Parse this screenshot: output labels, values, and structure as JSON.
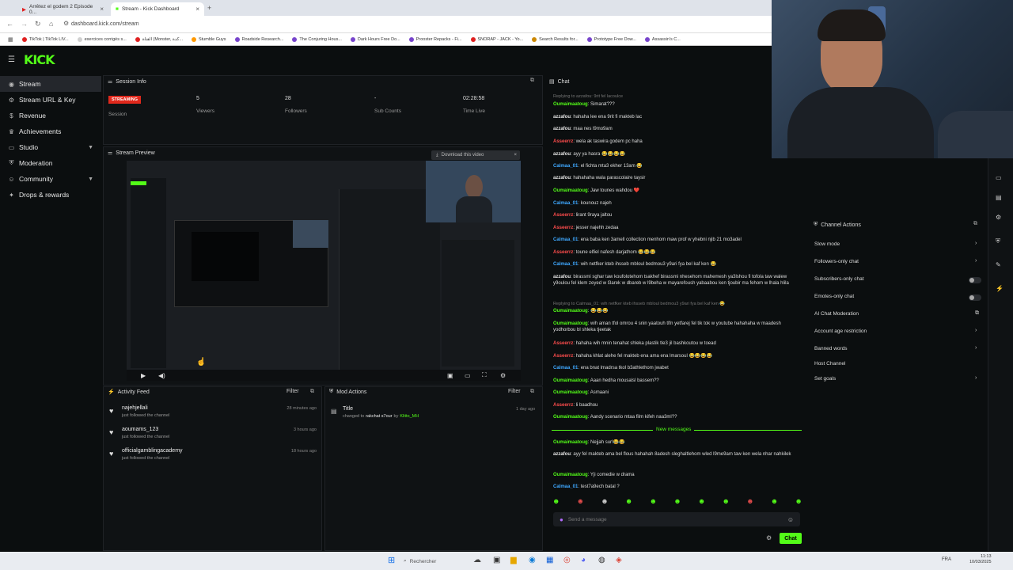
{
  "browser": {
    "tabs": [
      {
        "label": "Arrêtez el godem 2 Episode 0..."
      },
      {
        "label": "Stream - Kick Dashboard"
      }
    ],
    "url": "dashboard.kick.com/stream",
    "bookmarks": [
      {
        "label": "TikTok | TikTok LIV...",
        "color": "#e02020"
      },
      {
        "label": "exercices corrigés s...",
        "color": "#d0d0d0"
      },
      {
        "label": "القناة (Monster, كدة...",
        "color": "#e02020"
      },
      {
        "label": "Stumble Guys",
        "color": "#ff9900"
      },
      {
        "label": "Roadside Research...",
        "color": "#7744cc"
      },
      {
        "label": "The Conjuring Hous...",
        "color": "#7744cc"
      },
      {
        "label": "Dark Hours Free Do...",
        "color": "#7744cc"
      },
      {
        "label": "Prooster Repacks - Fi...",
        "color": "#7744cc"
      },
      {
        "label": "SNORAP - JACK - Yo...",
        "color": "#e02020"
      },
      {
        "label": "Search Results for...",
        "color": "#cc8800"
      },
      {
        "label": "Prototype Free Dow...",
        "color": "#7744cc"
      },
      {
        "label": "Assassin's C...",
        "color": "#7744cc"
      }
    ]
  },
  "app": {
    "logo": "KICK"
  },
  "sidebar": {
    "items": [
      {
        "label": "Stream",
        "icon": "broadcast-icon",
        "active": true
      },
      {
        "label": "Stream URL & Key",
        "icon": "gear-icon"
      },
      {
        "label": "Revenue",
        "icon": "dollar-icon"
      },
      {
        "label": "Achievements",
        "icon": "trophy-icon"
      },
      {
        "label": "Studio",
        "icon": "monitor-icon",
        "chevron": true
      },
      {
        "label": "Moderation",
        "icon": "shield-icon"
      },
      {
        "label": "Community",
        "icon": "users-icon",
        "chevron": true
      },
      {
        "label": "Drops & rewards",
        "icon": "gift-icon"
      }
    ]
  },
  "session": {
    "title": "Session Info",
    "badge": "STREAMING",
    "session_label": "Session",
    "stats": [
      {
        "value": "5",
        "label": "Viewers"
      },
      {
        "value": "28",
        "label": "Followers"
      },
      {
        "value": "-",
        "label": "Sub Counts"
      },
      {
        "value": "02:28:58",
        "label": "Time Live"
      }
    ]
  },
  "preview": {
    "title": "Stream Preview",
    "download_label": "Download this video"
  },
  "activity": {
    "title": "Activity Feed",
    "filter": "Filter",
    "items": [
      {
        "name": "najehjellali",
        "sub": "just followed the channel",
        "time": "28 minutes ago"
      },
      {
        "name": "aoumams_123",
        "sub": "just followed the channel",
        "time": "3 hours ago"
      },
      {
        "name": "officialgamblingacademy",
        "sub": "just followed the channel",
        "time": "18 hours ago"
      }
    ]
  },
  "mod": {
    "title": "Mod Actions",
    "filter": "Filter",
    "item": {
      "name": "Title",
      "desc": "changed to",
      "value": "rakchat s7our",
      "by": "by",
      "mod": "Klitto_MH",
      "time": "1 day ago"
    }
  },
  "chat": {
    "title": "Chat",
    "top_reply": "Replying to azzafou: 9rit fel lacoulce",
    "messages": [
      {
        "user": "Oumaimaatoug",
        "text": "Simarat???",
        "color": "#53fc18"
      },
      {
        "user": "azzafou",
        "text": "hahaha lee ena 9rit fi makteb lac",
        "color": "#e6e6e6"
      },
      {
        "user": "azzafou",
        "text": "maa nes l9mo9am",
        "color": "#e6e6e6"
      },
      {
        "user": "Asseerrz",
        "text": "wela ak taswira godem pc haha",
        "color": "#ff4d4d"
      },
      {
        "user": "azzafou",
        "text": "ayy ya hasra 😂😂😂😂",
        "color": "#e6e6e6"
      },
      {
        "user": "Calmaa_01",
        "text": "el fichta mta3 ekher 13am 😂",
        "color": "#3fa8ff"
      },
      {
        "user": "azzafou",
        "text": "hahahaha wala parascolaire taysir",
        "color": "#e6e6e6"
      },
      {
        "user": "Oumaimaatoug",
        "text": "Jaw tounes wahdou ❤️",
        "color": "#53fc18"
      },
      {
        "user": "Calmaa_01",
        "text": "kounouz najeh",
        "color": "#3fa8ff"
      },
      {
        "user": "Asseerrz",
        "text": "lirant 9raya jaltou",
        "color": "#ff4d4d"
      },
      {
        "user": "Asseerrz",
        "text": "jesser najehh zedaa",
        "color": "#ff4d4d"
      },
      {
        "user": "Calmaa_01",
        "text": "ena baba ken 3amell collection menhom maw prof w yhebni njib 21 mo3adel",
        "color": "#3fa8ff"
      },
      {
        "user": "Asseerrz",
        "text": "toune elfiel nafesh darjathom 😂😂😂",
        "color": "#ff4d4d"
      },
      {
        "user": "Calmaa_01",
        "text": "wih netfker kteb ihsseb mbloul bedmou3 y9ari fya bel kaf ken 😂",
        "color": "#3fa8ff"
      },
      {
        "user": "azzafou",
        "text": "birassmi sghar taw koufolotehom tsakhef birassmi nhesehom mahemesh ya3lshou fi tofola taw walew y9oulou fel klem zeyed w l3arek w dbareb w l9beha w mayarefoush yabaabou ken tjoubir ma fehom w lhala hlila",
        "color": "#e6e6e6"
      },
      {
        "user": "Oumaimaatoug",
        "text": "😂😂😂",
        "color": "#53fc18"
      },
      {
        "user": "Oumaimaatoug",
        "text": "wih aman tfol omrou 4 snin yaatouh tlfn yetfarej fel tik tok w youtube hahahaha w maadesh yodhorbou bl shleka tjeetak",
        "color": "#53fc18"
      },
      {
        "user": "Asseerrz",
        "text": "hahaha wih mnin tenahat shleka plastik tle3 jil bashkoutou w toead",
        "color": "#ff4d4d"
      },
      {
        "user": "Asseerrz",
        "text": "hahaha khlat alehe fel makteb ena ama ena lmarsoul 😂😂😂😂",
        "color": "#ff4d4d"
      },
      {
        "user": "Calmaa_01",
        "text": "ena bnat lmadrsa tkol b3athlethom jwabet",
        "color": "#3fa8ff"
      },
      {
        "user": "Oumaimaatoug",
        "text": "Aaan hedha mousalsl bassem??",
        "color": "#53fc18"
      },
      {
        "user": "Oumaimaatoug",
        "text": "Asmaani",
        "color": "#53fc18"
      },
      {
        "user": "Asseerrz",
        "text": "li baadhou",
        "color": "#ff4d4d"
      },
      {
        "user": "Oumaimaatoug",
        "text": "Aandy scenario mtaa film kifeh naa3ml??",
        "color": "#53fc18"
      },
      {
        "user": "Oumaimaatoug",
        "text": "Nejjah sur!😂😂",
        "color": "#53fc18"
      },
      {
        "user": "azzafou",
        "text": "ayy fel makteb ama bel flous hahahah 8adesh sleghaltlehom wled l9me9am taw ken wela nhar nahkilek",
        "color": "#e6e6e6"
      },
      {
        "user": "Oumaimaatoug",
        "text": "Yji comedie w drama",
        "color": "#53fc18"
      },
      {
        "user": "Calmaa_01",
        "text": "test7a9ech batal ?",
        "color": "#3fa8ff"
      }
    ],
    "reply2": "Replying to Calmaa_01: wih netfker kteb ihsseb mbloul bedmou3 y9ari fya bel kaf ken 😂",
    "new_messages": "New messages",
    "input_placeholder": "Send a message",
    "send_label": "Chat"
  },
  "channel_actions": {
    "title": "Channel Actions",
    "items": [
      {
        "label": "Slow mode",
        "control": "chevron"
      },
      {
        "label": "Followers-only chat",
        "control": "chevron"
      },
      {
        "label": "Subscribers-only chat",
        "control": "toggle"
      },
      {
        "label": "Emotes-only chat",
        "control": "toggle"
      },
      {
        "label": "AI Chat Moderation",
        "control": "external"
      },
      {
        "label": "Account age restriction",
        "control": "chevron"
      },
      {
        "label": "Banned words",
        "control": "chevron"
      },
      {
        "label": "Host Channel",
        "control": "none"
      },
      {
        "label": "Set goals",
        "control": "chevron"
      }
    ]
  },
  "taskbar": {
    "search": "Rechercher",
    "lang": "FRA",
    "time": "11:13",
    "date": "10/03/2025"
  },
  "colors": {
    "brand": "#53fc18",
    "streaming": "#e0281c"
  }
}
